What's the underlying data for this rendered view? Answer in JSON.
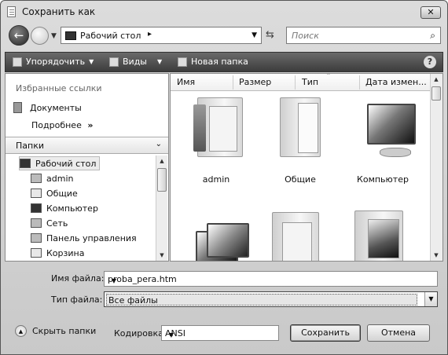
{
  "window": {
    "title": "Сохранить как",
    "close_label": "✕"
  },
  "address": {
    "location": "Рабочий стол",
    "search_placeholder": "Поиск"
  },
  "toolbar": {
    "organize": "Упорядочить",
    "views": "Виды",
    "new_folder": "Новая папка",
    "help": "?"
  },
  "favorites": {
    "title": "Избранные ссылки",
    "items": [
      {
        "label": "Документы",
        "icon": "documents-icon"
      }
    ],
    "more_label": "Подробнее",
    "more_chevron": "»"
  },
  "folders": {
    "header": "Папки",
    "tree": [
      {
        "label": "Рабочий стол",
        "icon": "desktop-icon",
        "selected": true
      },
      {
        "label": "admin",
        "icon": "user-folder-icon"
      },
      {
        "label": "Общие",
        "icon": "folder-icon"
      },
      {
        "label": "Компьютер",
        "icon": "computer-icon"
      },
      {
        "label": "Сеть",
        "icon": "network-icon"
      },
      {
        "label": "Панель управления",
        "icon": "control-panel-icon"
      },
      {
        "label": "Корзина",
        "icon": "recycle-bin-icon"
      }
    ]
  },
  "columns": [
    "Имя",
    "Размер",
    "Тип",
    "Дата измен..."
  ],
  "files": [
    {
      "label": "admin",
      "icon": "user-folder-icon"
    },
    {
      "label": "Общие",
      "icon": "folder-icon"
    },
    {
      "label": "Компьютер",
      "icon": "computer-icon"
    },
    {
      "label": "",
      "icon": "network-icon"
    },
    {
      "label": "",
      "icon": "documents-folder-icon"
    },
    {
      "label": "",
      "icon": "pictures-folder-icon"
    }
  ],
  "form": {
    "filename_label": "Имя файла:",
    "filename_value": "proba_pera.htm",
    "filetype_label": "Тип файла:",
    "filetype_value": "Все файлы",
    "hide_folders": "Скрыть папки",
    "encoding_label": "Кодировка:",
    "encoding_value": "ANSI",
    "save": "Сохранить",
    "cancel": "Отмена"
  }
}
